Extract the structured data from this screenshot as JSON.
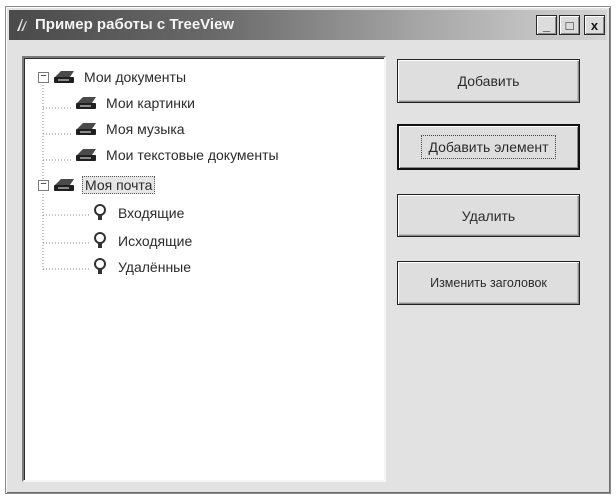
{
  "window": {
    "title": "Пример работы с TreeView",
    "title_icon": "app-icon",
    "buttons": {
      "minimize": "_",
      "maximize": "□",
      "close": "x"
    }
  },
  "tree": {
    "nodes": [
      {
        "label": "Мои документы",
        "icon": "printer-icon",
        "expander": "−",
        "level": 0,
        "selected": false
      },
      {
        "label": "Мои картинки",
        "icon": "printer-icon",
        "level": 1
      },
      {
        "label": "Моя музыка",
        "icon": "printer-icon",
        "level": 1
      },
      {
        "label": "Мои текстовые документы",
        "icon": "printer-icon",
        "level": 1
      },
      {
        "label": "Моя почта",
        "icon": "printer-icon",
        "expander": "−",
        "level": 0,
        "selected": true
      },
      {
        "label": "Входящие",
        "icon": "lightbulb-icon",
        "level": 1
      },
      {
        "label": "Исходящие",
        "icon": "lightbulb-icon",
        "level": 1
      },
      {
        "label": "Удалённые",
        "icon": "lightbulb-icon",
        "level": 1
      }
    ]
  },
  "actions": {
    "add": "Добавить",
    "add_item": "Добавить элемент",
    "delete": "Удалить",
    "rename": "Изменить заголовок"
  }
}
